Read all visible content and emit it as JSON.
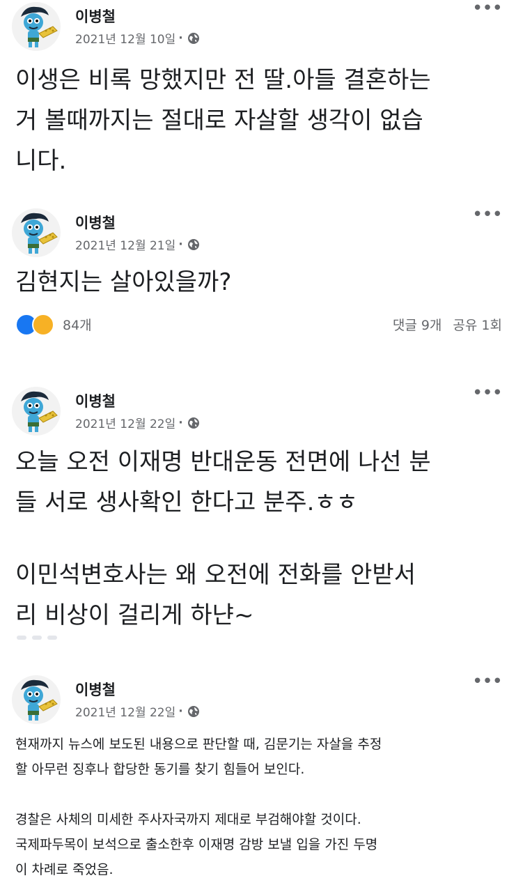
{
  "posts": [
    {
      "author": "이병철",
      "date": "2021년 12월 10일",
      "dot": "·",
      "paragraphs": [
        "이생은 비록 망했지만 전 딸.아들 결혼하는\n거 볼때까지는 절대로 자살할 생각이 없습\n니다."
      ]
    },
    {
      "author": "이병철",
      "date": "2021년 12월 21일",
      "dot": "·",
      "paragraphs": [
        "김현지는 살아있을까?"
      ],
      "reactions": {
        "count": "84개",
        "comments": "댓글 9개",
        "shares": "공유 1회"
      }
    },
    {
      "author": "이병철",
      "date": "2021년 12월 22일",
      "dot": "·",
      "paragraphs": [
        "오늘 오전 이재명 반대운동 전면에 나선 분\n들 서로 생사확인 한다고 분주.ㅎㅎ",
        "이민석변호사는 왜 오전에 전화를 안받서\n리 비상이 걸리게 하냔~"
      ]
    },
    {
      "author": "이병철",
      "date": "2021년 12월 22일",
      "dot": "·",
      "paragraphs": [
        "현재까지 뉴스에 보도된 내용으로 판단할 때, 김문기는 자살을 추정\n할 아무런 징후나 합당한 동기를 찾기 힘들어 보인다.",
        "경찰은 사체의 미세한 주사자국까지 제대로 부검해야할 것이다.\n국제파두목이 보석으로 출소한후 이재명 감방 보낼 입을 가진 두명\n이 차례로 죽었음."
      ]
    }
  ],
  "icons": {
    "more": "more-options-icon",
    "privacy": "globe-icon",
    "like": "like-reaction-icon",
    "wow": "wow-reaction-icon"
  },
  "colors": {
    "text": "#1c1e21",
    "meta": "#65676b",
    "like": "#1877f2",
    "wow": "#f7b125"
  }
}
